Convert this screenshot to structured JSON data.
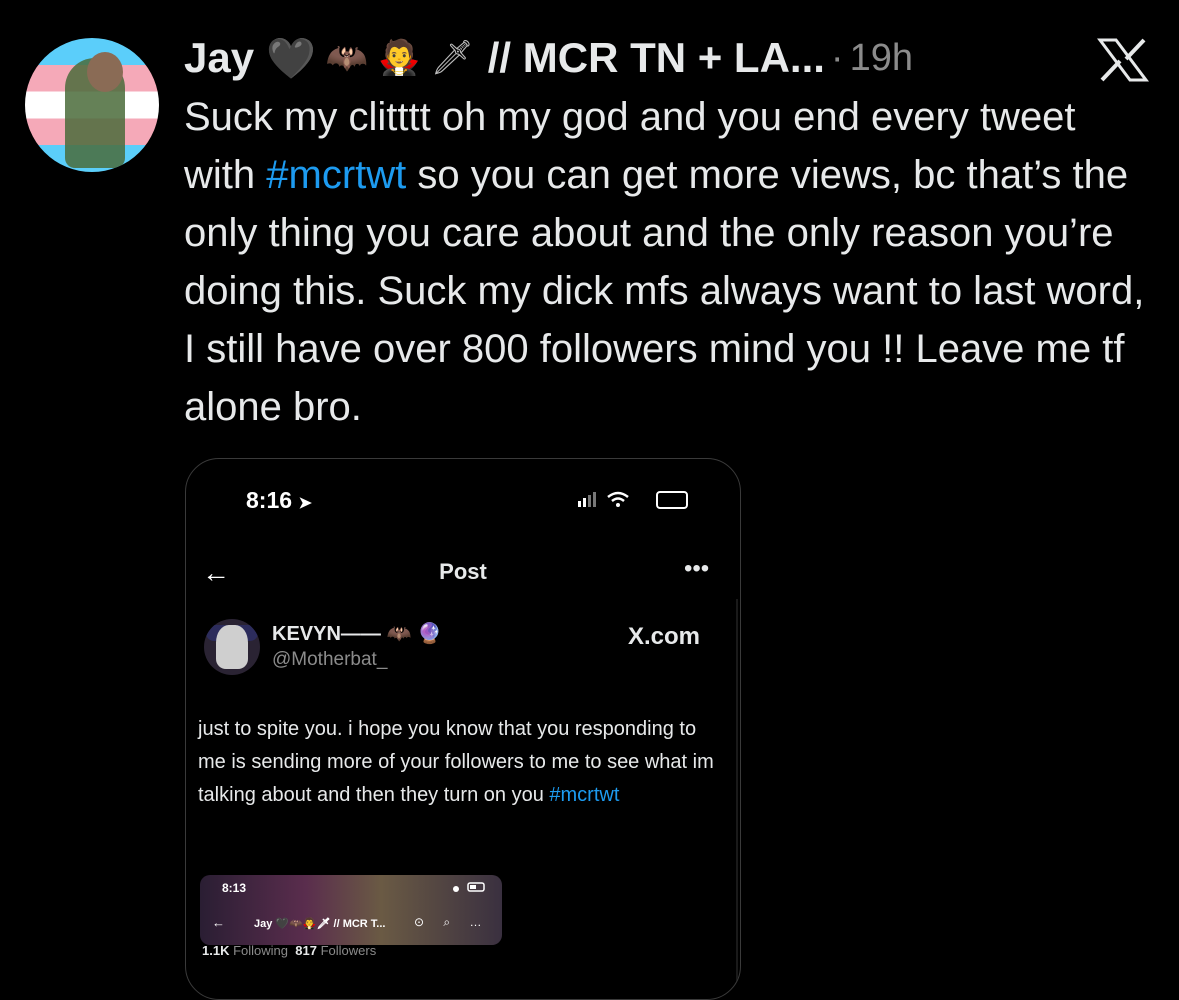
{
  "tweet": {
    "author_name": "Jay",
    "emojis": [
      "🖤",
      "🦇",
      "🧛",
      "🗡"
    ],
    "display_tag": "// MCR TN + LA...",
    "separator": "·",
    "time": "19h",
    "text_parts": [
      "Suck my clitttt oh my god and you end every tweet with ",
      "#mcrtwt",
      " so you can get more views, bc that’s the only thing you care about and the only reason you’re doing this. Suck my dick mfs always want to last word, I still have over 800 followers mind you !! Leave me tf alone bro."
    ]
  },
  "platform_icon": "x-logo-icon",
  "screenshot": {
    "status_time": "8:16",
    "status_arrow": "➤",
    "header_title": "Post",
    "back_icon": "←",
    "more_icon": "•••",
    "account_name": "KEVYN——",
    "account_handle": "@Motherbat_",
    "watermark": "X.com",
    "text_parts": [
      "just to spite you. i hope you know that you responding to me is sending more of your followers to me to see what im talking about and then they turn on you ",
      "#mcrtwt"
    ],
    "inner": {
      "time": "8:13",
      "name": "Jay",
      "tag": "// MCR T...",
      "following_count": "1.1K",
      "following_label": "Following",
      "followers_count": "817",
      "followers_label": "Followers"
    }
  },
  "colors": {
    "background": "#000000",
    "text": "#e7e9ea",
    "muted": "#8b8b8b",
    "link": "#1d9bf0"
  }
}
